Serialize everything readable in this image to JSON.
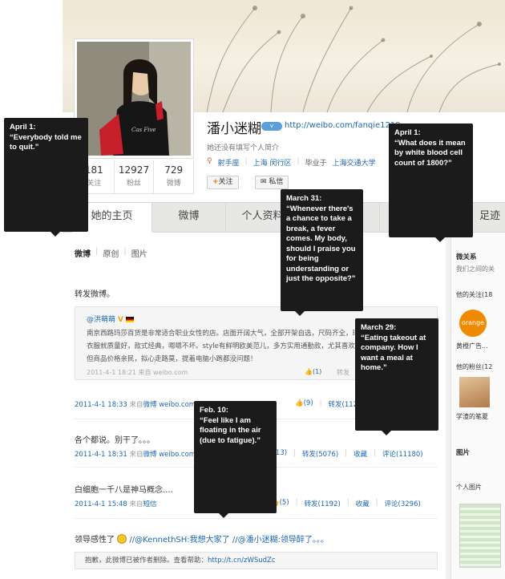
{
  "profile": {
    "name": "潘小迷糊",
    "vbadge": "v",
    "url": "http://weibo.com/fanqie1219",
    "intro": "她还没有填写个人简介",
    "meta": {
      "sign": "射手座",
      "location": "上海 闵行区",
      "school_prefix": "毕业于",
      "school": "上海交通大学"
    },
    "stats": [
      {
        "num": "181",
        "label": "关注"
      },
      {
        "num": "12927",
        "label": "粉丝"
      },
      {
        "num": "729",
        "label": "微博"
      }
    ],
    "follow_label": "关注",
    "message_label": "私信"
  },
  "tabs": [
    "她的主页",
    "微博",
    "个人资料",
    "足迹"
  ],
  "subtabs": [
    "微博",
    "原创",
    "图片"
  ],
  "posts": {
    "p1": {
      "text": "转发微博。",
      "quote_author": "@洪萌萌",
      "quote_badge": "V",
      "quote_body": "南京西路玛莎百货是非常适合职业女性的店。店面开阔大气，全部开架自选，尺码齐全，环境舒适，服务周到，衣服就质量好，款式经典，嗯嗯不坏。style有鲜明欧美范儿，多方实用通勤款，尤其喜欢别致但不夸张的设计，但商品价格亲民，拟心走路莫，提着电脑小跑都没问题！",
      "quote_time": "2011-4-1 18:21",
      "quote_via": "来自 weibo.com",
      "quote_like": "(1)",
      "quote_forward": "转发",
      "time": "2011-4-1 18:33",
      "via_prefix": "来自",
      "via": "微博 weibo.com",
      "like": "(9)",
      "forward": "转发(1123)"
    },
    "p2": {
      "text": "各个都说。别干了。。。",
      "time": "2011-4-1 18:31",
      "via_prefix": "来自",
      "via": "微博 weibo.com",
      "like": "(13)",
      "forward": "转发(5076)",
      "fav": "收藏",
      "comment": "评论(11180)"
    },
    "p3": {
      "text": "白细胞一千八是神马概念....",
      "time": "2011-4-1 15:48",
      "via_prefix": "来自",
      "via": "短信",
      "like": "(5)",
      "forward": "转发(1192)",
      "fav": "收藏",
      "comment": "评论(3296)"
    },
    "p4": {
      "text_a": "领导感性了",
      "text_b": "//@KennethSH:我想大家了 //@潘小迷糊:领导醉了。。。",
      "deleted": "抱歉，此微博已被作者删除。查看帮助：",
      "deleted_link": "http://t.cn/zWSudZc"
    }
  },
  "sidebar": {
    "relations_title": "微关系",
    "relations_sub": "我们之间的关",
    "follows_title": "他的关注(18",
    "follow_logo": "orange",
    "follow_name": "黄橙广告...",
    "fans_title": "他的粉丝(12",
    "fan_name": "学渣的笔夏",
    "pics_title": "图片",
    "pics_sub": "个人图片"
  },
  "callouts": [
    {
      "date": "April 1:",
      "text": "“Everybody told me to quit.”"
    },
    {
      "date": "April 1:",
      "text": "“What does it mean by white blood cell count of 1800?”"
    },
    {
      "date": "March 31:",
      "text": "“Whenever there's a chance to take a break, a fever comes. My body, should I praise you for being understanding or just the opposite?”"
    },
    {
      "date": "March 29:",
      "text": "“Eating takeout at company. How I want a meal at home.”"
    },
    {
      "date": "Feb. 10:",
      "text": "“Feel like I am floating in the air (due to fatigue).”"
    }
  ]
}
